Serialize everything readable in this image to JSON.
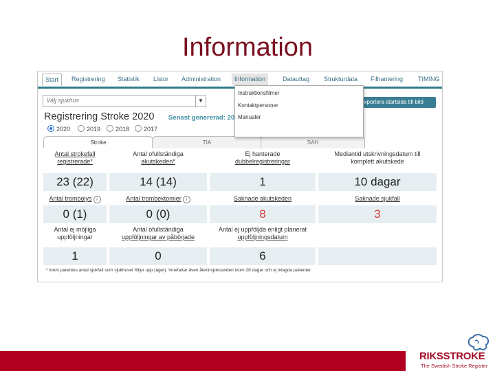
{
  "slide": {
    "title": "Information"
  },
  "nav": {
    "items": [
      "Start",
      "Registrering",
      "Statistik",
      "Listor",
      "Administration",
      "Information",
      "Datauttag",
      "Strukturdata",
      "Filhantering",
      "TIMING"
    ],
    "active": "Start",
    "open": "Information"
  },
  "dropdown": {
    "items": [
      "Instruktionsfilmer",
      "Kontaktpersoner",
      "Manualer"
    ]
  },
  "hospital": {
    "placeholder": "Välj sjukhus",
    "arrow": "▼"
  },
  "page": {
    "title": "Registrering Stroke 2020",
    "generated": "Senast genererad: 20",
    "export_button": "Exportera startsida till bild"
  },
  "years": {
    "options": [
      "2020",
      "2019",
      "2018",
      "2017"
    ],
    "selected": "2020"
  },
  "tabs": [
    "Stroke",
    "TIA",
    "SAH"
  ],
  "stats": {
    "row1_labels": [
      [
        "Antal strokefall",
        "registrerade*"
      ],
      [
        "Antal ofullständiga",
        "akutskeden*"
      ],
      [
        "Ej hanterade",
        "dubbelregistreringar"
      ],
      [
        "Mediantid utskrivningsdatum till",
        "komplett akutskede"
      ]
    ],
    "row1_values": [
      "23 (22)",
      "14 (14)",
      "1",
      "10 dagar"
    ],
    "row2_labels": [
      "Antal trombolys",
      "Antal trombektomier",
      "Saknade akutskeden",
      "Saknade sjukfall"
    ],
    "row2_values": [
      "0 (1)",
      "0 (0)",
      "8",
      "3"
    ],
    "row3_labels": [
      [
        "Antal ej möjliga",
        "uppföljningar"
      ],
      [
        "Antal ofullständiga",
        "uppföljningar av påbörjade"
      ],
      [
        "Antal ej uppföljda enligt planerat",
        "uppföljningsdatum"
      ]
    ],
    "row3_values": [
      "1",
      "0",
      "6"
    ],
    "info_icon": "i"
  },
  "footnote": "* Inom parentes antal sjukfall som sjukhuset följer upp (äger). Innefattar även återinsjuknanden inom 28 dagar och ej inlagda patienter.",
  "logo": {
    "name": "RIKSSTROKE",
    "subtitle": "The Swedish Stroke Register"
  },
  "colors": {
    "accent": "#2f7a8a",
    "brand": "#b1001f",
    "alert": "#d63b3b",
    "value_bg": "#e7eef2"
  }
}
